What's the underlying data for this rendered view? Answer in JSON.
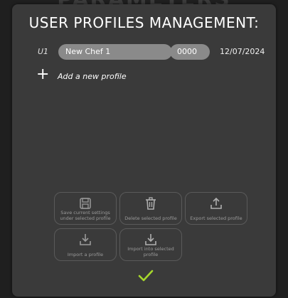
{
  "background_title": "PARAMETERS",
  "title": "USER PROFILES MANAGEMENT:",
  "profile": {
    "id": "U1",
    "name": "New Chef 1",
    "pin": "0000",
    "date": "12/07/2024"
  },
  "add_profile": {
    "icon": "plus-icon",
    "label": "Add a new profile"
  },
  "actions": {
    "save": {
      "icon": "floppy-disk-icon",
      "label": "Save current settings under selected profile"
    },
    "delete": {
      "icon": "trash-icon",
      "label": "Delete selected profile"
    },
    "export": {
      "icon": "upload-icon",
      "label": "Export selected profile"
    },
    "import": {
      "icon": "download-icon",
      "label": "Import a profile"
    },
    "import_into": {
      "icon": "download-icon",
      "label": "Import into selected profile"
    }
  },
  "confirm": {
    "icon": "checkmark-icon"
  },
  "colors": {
    "panel": "#3a3a3a",
    "field": "#8a8a8a",
    "accent_check": "#a6d72c",
    "disabled_text": "#9a9a9a"
  }
}
